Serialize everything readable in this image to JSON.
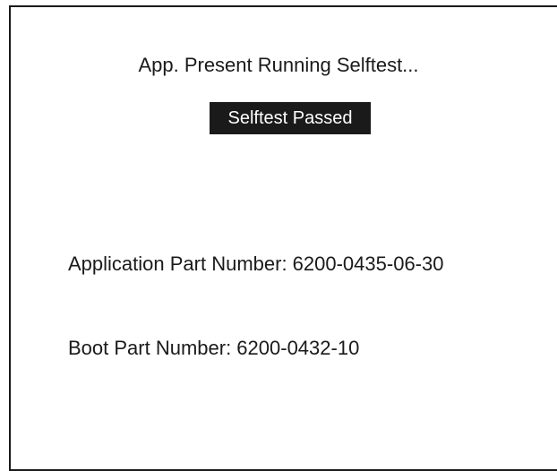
{
  "selftest": {
    "status": "App. Present Running Selftest...",
    "result": "Selftest Passed"
  },
  "part_numbers": {
    "application": "Application Part Number: 6200-0435-06-30",
    "boot": "Boot Part Number: 6200-0432-10"
  },
  "colors": {
    "foreground": "#1a1a1a",
    "background": "#ffffff",
    "badge_text": "#ffffff"
  }
}
